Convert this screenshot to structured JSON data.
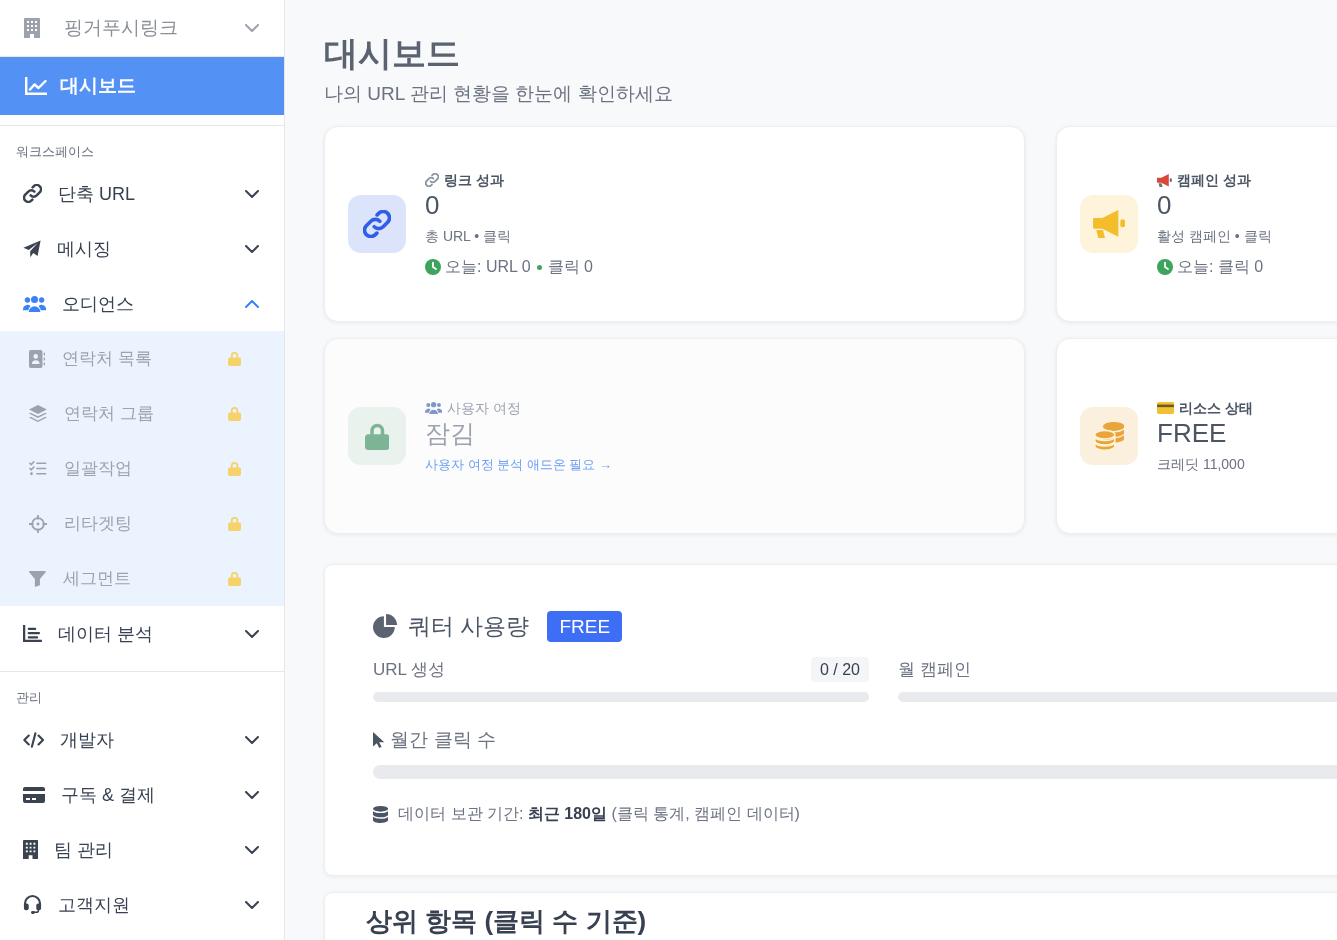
{
  "sidebar": {
    "workspace": {
      "name": "핑거푸시링크",
      "expanded": false
    },
    "dashboard": {
      "label": "대시보드",
      "selected": true
    },
    "sections": [
      {
        "title": "워크스페이스",
        "items": [
          {
            "label": "단축 URL",
            "selected": false,
            "expanded": false
          },
          {
            "label": "메시징",
            "selected": false,
            "expanded": false
          },
          {
            "label": "오디언스",
            "selected": false,
            "expanded": true,
            "children": [
              {
                "label": "연락처 목록",
                "selected": false,
                "locked": true
              },
              {
                "label": "연락처 그룹",
                "selected": false,
                "locked": true
              },
              {
                "label": "일괄작업",
                "selected": false,
                "locked": true
              },
              {
                "label": "리타겟팅",
                "selected": false,
                "locked": true
              },
              {
                "label": "세그먼트",
                "selected": false,
                "locked": true
              }
            ]
          },
          {
            "label": "데이터 분석",
            "selected": false,
            "expanded": false
          }
        ]
      },
      {
        "title": "관리",
        "items": [
          {
            "label": "개발자",
            "selected": false,
            "expanded": false
          },
          {
            "label": "구독 & 결제",
            "selected": false,
            "expanded": false
          },
          {
            "label": "팀 관리",
            "selected": false,
            "expanded": false
          },
          {
            "label": "고객지원",
            "selected": false,
            "expanded": false
          }
        ]
      }
    ]
  },
  "header": {
    "title": "대시보드",
    "subtitle": "나의 URL 관리 현황을 한눈에 확인하세요"
  },
  "stat_cards": [
    {
      "kind": "stat",
      "color": "#2f5fe8",
      "label": "링크 성과",
      "value": "0",
      "caption": "총 URL • 클릭",
      "today": [
        "오늘: URL 0",
        "클릭 0"
      ]
    },
    {
      "kind": "stat",
      "color": "#f3bd2b",
      "label": "캠페인 성과",
      "value": "0",
      "caption": "활성 캠페인 • 클릭",
      "today": [
        "오늘: 클릭 0"
      ]
    },
    {
      "kind": "locked",
      "color": "#7db496",
      "label": "사용자 여정",
      "value": "잠김",
      "link": "사용자 여정 분석 애드온 필요 →"
    },
    {
      "kind": "stat",
      "color": "#e9a53a",
      "label": "리소스 상태",
      "value": "FREE",
      "caption": "크레딧 11,000"
    }
  ],
  "quota": {
    "title": "쿼터 사용량",
    "badge": "FREE",
    "meters": [
      {
        "label": "URL 생성",
        "count": "0 / 20",
        "level": 0
      },
      {
        "label": "월 캠페인",
        "level": 0
      }
    ],
    "clicks": {
      "label": "월간 클릭 수",
      "level": 0
    },
    "retention": "데이터 보관 기간: **최근 180일** (클릭 통계, 캠페인 데이터)"
  },
  "top_items": {
    "title": "상위 항목 (클릭 수 기준)"
  }
}
